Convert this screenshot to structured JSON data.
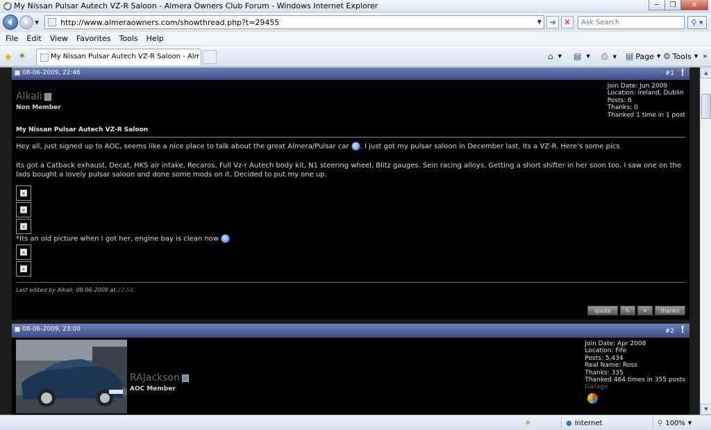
{
  "window": {
    "title": "My Nissan Pulsar Autech VZ-R Saloon - Almera Owners Club Forum - Windows Internet Explorer"
  },
  "address": {
    "url": "http://www.almeraowners.com/showthread.php?t=29455",
    "search_placeholder": "Ask Search"
  },
  "menu": {
    "items": [
      "File",
      "Edit",
      "View",
      "Favorites",
      "Tools",
      "Help"
    ]
  },
  "tab": {
    "label": "My Nissan Pulsar Autech VZ-R Saloon - Almera O..."
  },
  "commands": {
    "page_label": "Page",
    "tools_label": "Tools"
  },
  "posts": [
    {
      "date": "08-06-2009, 22:46",
      "number": "#1",
      "excl": "!",
      "username": "Alkali",
      "rank": "Non Member",
      "info": [
        "Join Date: Jun 2009",
        "Location: Ireland, Dublin",
        "Posts: 6",
        "Thanks: 0",
        "Thanked 1 time in 1 post"
      ],
      "title": "My Nissan Pulsar Autech VZ-R Saloon",
      "text1a": "Hey all, just signed up to AOC, seems like a nice place to talk about the great Almera/Pulsar car",
      "text1b": ". I just got my pulsar saloon in December last. Its a VZ-R. Here's some pics",
      "text2": "Its got a Catback exhaust, Decat, HKS air intake, Recaros, Full Vz-r Autech body kit, N1 steering wheel, Blitz gauges. Sein racing alloys, Getting a short shifter in her soon too. I saw one on the lads bought a lovely pulsar saloon and done some mods on it. Decided to put my one up.",
      "text3": "*Its an old picture when I got her, engine bay is clean now",
      "edit_prefix": "Last edited by Alkali; 08-06-2009 at ",
      "edit_time": "22:50",
      "edit_suffix": ".",
      "buttons": [
        "quote",
        "thanks"
      ]
    },
    {
      "date": "08-06-2009, 23:00",
      "number": "#2",
      "excl": "!",
      "username": "RAJackson",
      "rank": "AOC Member",
      "info": [
        "Join Date: Apr 2008",
        "Location: Fife",
        "Posts: 5,434",
        "Real Name: Ross",
        "Thanks: 335",
        "Thanked 464 times in 355 posts"
      ],
      "garage": "Garage"
    }
  ],
  "status": {
    "zone": "Internet",
    "zoom": "100%"
  },
  "colors": {
    "post_header": "#3b4c86",
    "page_bg": "#1d1d1d",
    "post_bg": "#000000"
  }
}
